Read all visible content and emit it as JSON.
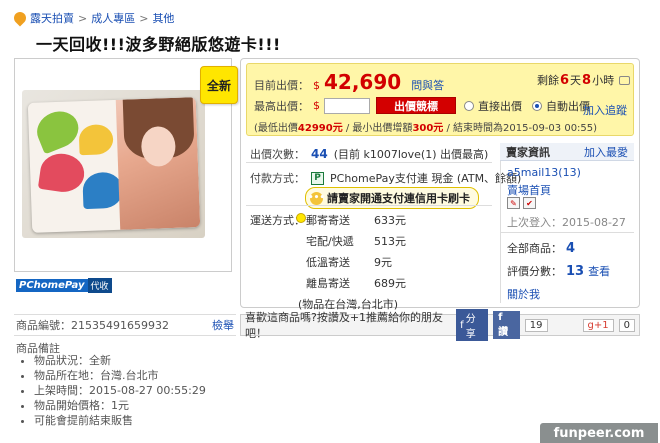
{
  "breadcrumb": {
    "items": [
      "露天拍賣",
      "成人專區",
      "其他"
    ],
    "sep": ">"
  },
  "title": "一天回收!!!波多野絕版悠遊卡!!!",
  "badge_new": "全新",
  "pchome_pay": {
    "brand": "PChomePay",
    "sub": "代收"
  },
  "price": {
    "current_label": "目前出價：",
    "currency": "$",
    "current_value": "42,690",
    "ask_label": "問與答",
    "remain_prefix": "剩餘",
    "remain_days": "6",
    "remain_days_unit": "天",
    "remain_hours": "8",
    "remain_hours_unit": "小時",
    "max_label": "最高出價：",
    "max_currency": "$",
    "bid_button": "出價競標",
    "radio_direct": "直接出價",
    "radio_auto": "自動出價",
    "add_track": "加入追蹤",
    "note_prefix": "(最低出價",
    "note_min": "42990元",
    "note_mid": " / 最小出價增額",
    "note_inc": "300元",
    "note_suffix": " / 結束時間為2015-09-03 00:55)"
  },
  "info": {
    "count_label": "出價次數：",
    "count_value": "44",
    "count_detail": "(目前 k1007love(1) 出價最高)",
    "pay_label": "付款方式：",
    "pay_value": "PChomePay支付連 現金 (ATM、餘額)",
    "pay_notice": "請賣家開通支付連信用卡刷卡",
    "ship_label": "運送方式：",
    "shipping": [
      {
        "name": "郵寄寄送",
        "price": "633元"
      },
      {
        "name": "宅配/快遞",
        "price": "513元"
      },
      {
        "name": "低溫寄送",
        "price": "9元"
      },
      {
        "name": "離島寄送",
        "price": "689元"
      }
    ],
    "location": "(物品在台灣,台北市)"
  },
  "seller": {
    "head_title": "賣家資訊",
    "add_fav": "加入最愛",
    "name": "a5mail13(13)",
    "store": "賣場首頁",
    "last_login": "上次登入：2015-08-27",
    "total_label": "全部商品：",
    "total_value": "4",
    "rating_label": "評價分數：",
    "rating_value": "13",
    "rating_link": "查看",
    "about": "關於我"
  },
  "share": {
    "text": "喜歡這商品嗎?按讚及+1推薦給你的朋友吧！",
    "fb_share": "分享",
    "fb_like": "讚",
    "fb_count": "19",
    "gplus": "g+1",
    "gplus_count": "0"
  },
  "product": {
    "id_label": "商品編號：21535491659932",
    "report": "檢舉",
    "notes_title": "商品備註",
    "notes": [
      "物品狀況：全新",
      "物品所在地：台灣.台北市",
      "上架時間：2015-08-27 00:55:29",
      "物品開始價格：1元",
      "可能會提前結束販售"
    ]
  },
  "watermark": "funpeer.com",
  "colors": {
    "price_red": "#d20000",
    "link_blue": "#1a4fb3",
    "highlight_yellow": "#fff6a8"
  }
}
